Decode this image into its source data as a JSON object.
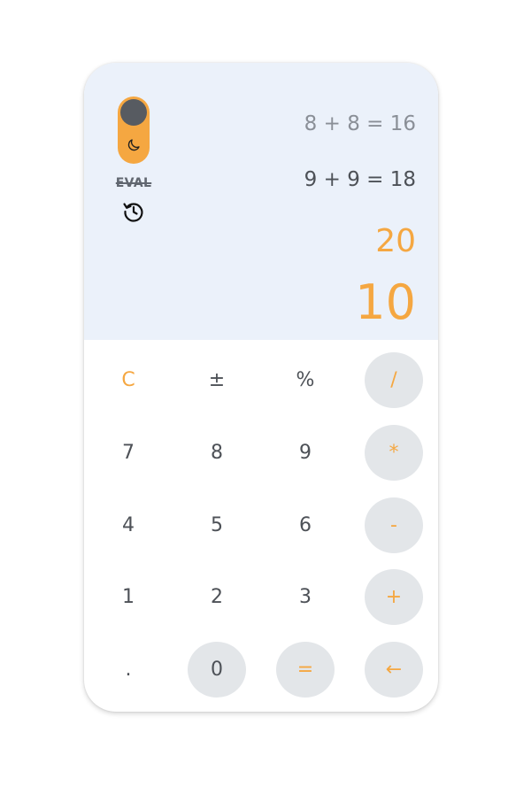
{
  "display": {
    "history": [
      "8 + 8 = 16",
      "9 + 9 = 18"
    ],
    "previous": "20",
    "current": "10"
  },
  "controls": {
    "eval_label": "EVAL",
    "theme_icon": "moon-icon",
    "history_icon": "history-icon"
  },
  "keypad": {
    "rows": [
      [
        {
          "label": "C"
        },
        {
          "label": "±"
        },
        {
          "label": "%"
        },
        {
          "label": "/"
        }
      ],
      [
        {
          "label": "7"
        },
        {
          "label": "8"
        },
        {
          "label": "9"
        },
        {
          "label": "*"
        }
      ],
      [
        {
          "label": "4"
        },
        {
          "label": "5"
        },
        {
          "label": "6"
        },
        {
          "label": "-"
        }
      ],
      [
        {
          "label": "1"
        },
        {
          "label": "2"
        },
        {
          "label": "3"
        },
        {
          "label": "+"
        }
      ],
      [
        {
          "label": "."
        },
        {
          "label": "0"
        },
        {
          "label": "="
        },
        {
          "label": "←"
        }
      ]
    ]
  },
  "colors": {
    "accent": "#f5a741",
    "screen_background": "#ebf1fa",
    "key_shade": "#e3e6e9",
    "text_dark": "#4d5157",
    "text_muted": "#8a8f97"
  }
}
